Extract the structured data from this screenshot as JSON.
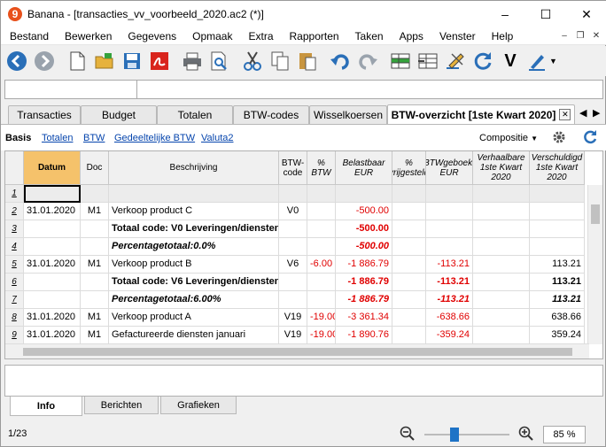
{
  "app": {
    "title": "Banana - [transacties_vv_voorbeeld_2020.ac2 (*)]",
    "icon_glyph": "9"
  },
  "window_controls": [
    "–",
    "☐",
    "✕"
  ],
  "menu": [
    "Bestand",
    "Bewerken",
    "Gegevens",
    "Opmaak",
    "Extra",
    "Rapporten",
    "Taken",
    "Apps",
    "Venster",
    "Help"
  ],
  "toolbar_icons": [
    "back-icon",
    "forward-icon",
    "new-file-icon",
    "open-folder-icon",
    "save-icon",
    "pdf-icon",
    "print-icon",
    "print-preview-icon",
    "cut-icon",
    "copy-icon",
    "paste-icon",
    "undo-icon",
    "redo-icon",
    "add-rows-icon",
    "delete-rows-icon",
    "edit-icon",
    "recheck-icon",
    "bold-v-icon",
    "pen-icon"
  ],
  "toolbar": {
    "verify_glyph": "V"
  },
  "tabs": [
    "Transacties",
    "Budget",
    "Totalen",
    "BTW-codes",
    "Wisselkoersen",
    "BTW-overzicht [1ste Kwart 2020]"
  ],
  "tab_close": "✕",
  "views": {
    "current": "Basis",
    "links": [
      "Totalen",
      "BTW",
      "Gedeeltelijke BTW",
      "Valuta2"
    ],
    "composition": "Compositie"
  },
  "columns": [
    {
      "label": "Datum"
    },
    {
      "label": "Doc"
    },
    {
      "label": "Beschrijving"
    },
    {
      "label": "BTW-code"
    },
    {
      "label": "% BTW"
    },
    {
      "label": "Belastbaar EUR"
    },
    {
      "label": "% vrijgesteld"
    },
    {
      "label": "BTWgeboekt EUR"
    },
    {
      "label": "Verhaalbare 1ste Kwart 2020"
    },
    {
      "label": "Verschuldigd 1ste Kwart 2020"
    }
  ],
  "rows": [
    {
      "n": "1",
      "datum": "",
      "doc": "",
      "desc": "",
      "code": "",
      "pct": "",
      "belast": "",
      "vrij": "",
      "geboekt": "",
      "verh": "",
      "versch": "",
      "style": "empty"
    },
    {
      "n": "2",
      "datum": "31.01.2020",
      "doc": "M1",
      "desc": "Verkoop product C",
      "code": "V0",
      "pct": "",
      "belast": "-500.00",
      "vrij": "",
      "geboekt": "",
      "verh": "",
      "versch": "",
      "style": "normal"
    },
    {
      "n": "3",
      "datum": "",
      "doc": "",
      "desc": "Totaal code: V0 Leveringen/diensten",
      "code": "",
      "pct": "",
      "belast": "-500.00",
      "vrij": "",
      "geboekt": "",
      "verh": "",
      "versch": "",
      "style": "total"
    },
    {
      "n": "4",
      "datum": "",
      "doc": "",
      "desc": "Percentagetotaal:0.0%",
      "code": "",
      "pct": "",
      "belast": "-500.00",
      "vrij": "",
      "geboekt": "",
      "verh": "",
      "versch": "",
      "style": "pct"
    },
    {
      "n": "5",
      "datum": "31.01.2020",
      "doc": "M1",
      "desc": "Verkoop product B",
      "code": "V6",
      "pct": "-6.00",
      "belast": "-1 886.79",
      "vrij": "",
      "geboekt": "-113.21",
      "verh": "",
      "versch": "113.21",
      "style": "normal"
    },
    {
      "n": "6",
      "datum": "",
      "doc": "",
      "desc": "Totaal code: V6 Leveringen/diensten",
      "code": "",
      "pct": "",
      "belast": "-1 886.79",
      "vrij": "",
      "geboekt": "-113.21",
      "verh": "",
      "versch": "113.21",
      "style": "total"
    },
    {
      "n": "7",
      "datum": "",
      "doc": "",
      "desc": "Percentagetotaal:6.00%",
      "code": "",
      "pct": "",
      "belast": "-1 886.79",
      "vrij": "",
      "geboekt": "-113.21",
      "verh": "",
      "versch": "113.21",
      "style": "pct"
    },
    {
      "n": "8",
      "datum": "31.01.2020",
      "doc": "M1",
      "desc": "Verkoop product A",
      "code": "V19",
      "pct": "-19.00",
      "belast": "-3 361.34",
      "vrij": "",
      "geboekt": "-638.66",
      "verh": "",
      "versch": "638.66",
      "style": "normal"
    },
    {
      "n": "9",
      "datum": "31.01.2020",
      "doc": "M1",
      "desc": "Gefactureerde diensten januari",
      "code": "V19",
      "pct": "-19.00",
      "belast": "-1 890.76",
      "vrij": "",
      "geboekt": "-359.24",
      "verh": "",
      "versch": "359.24",
      "style": "normal"
    }
  ],
  "bottom_tabs": [
    "Info",
    "Berichten",
    "Grafieken"
  ],
  "status": {
    "row_count": "1/23",
    "zoom": "85 %",
    "zoom_level": 0.35
  },
  "colors": {
    "accent": "#1e73c6",
    "header_highlight": "#f5c26b",
    "negative": "#e00000",
    "link": "#0645ad"
  }
}
